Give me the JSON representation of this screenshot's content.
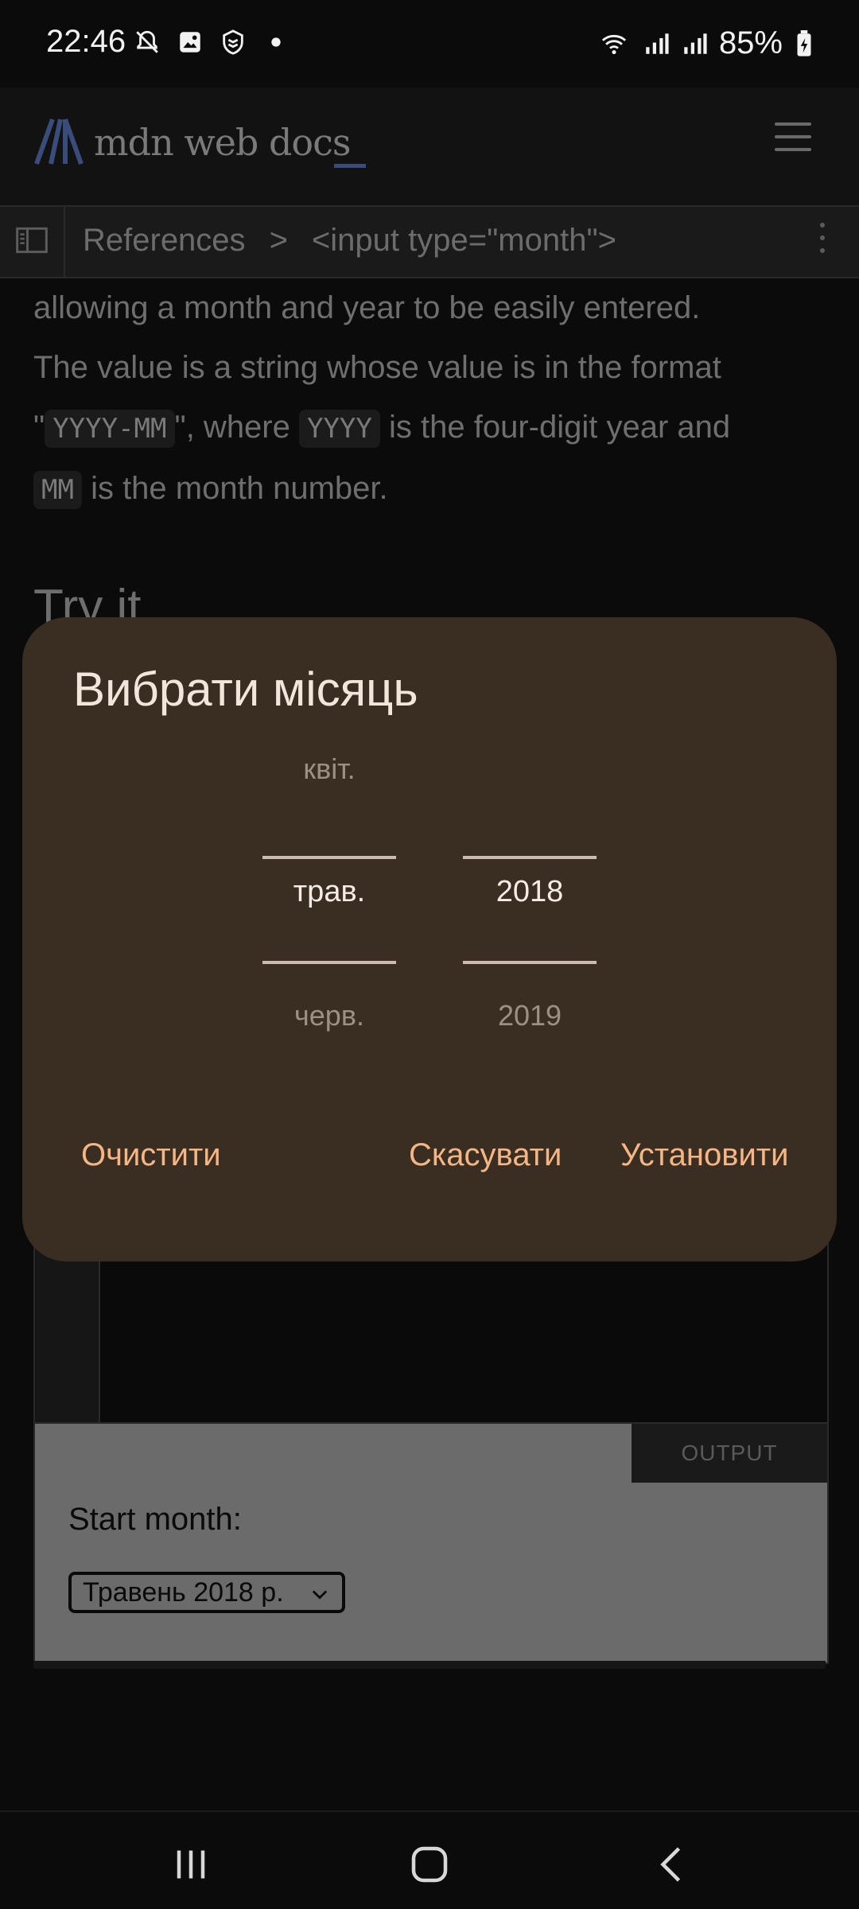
{
  "status_bar": {
    "time": "22:46",
    "battery": "85%",
    "left_icons": [
      "notifications-off-icon",
      "gallery-icon",
      "shield-icon",
      "dot-icon"
    ],
    "right_icons": [
      "wifi-icon",
      "signal-icon",
      "signal-icon",
      "battery-charging-icon"
    ]
  },
  "header": {
    "logo_text": "mdn web docs",
    "logo_cursor": "_",
    "menu_icon": "hamburger-icon"
  },
  "breadcrumb": {
    "items": [
      "References",
      ">",
      "<input type=\"month\">"
    ]
  },
  "article": {
    "line1": "allowing a month and year to be easily entered.",
    "line2": "The value is a string whose value is in the format",
    "q_open": "\"",
    "code1": "YYYY-MM",
    "mid1": "\", where ",
    "code2": "YYYY",
    "mid2": " is the four-digit year and",
    "code3": "MM",
    "mid3": " is the month number.",
    "try_it": "Try it"
  },
  "output": {
    "tab_label": "OUTPUT",
    "start_label": "Start month:",
    "select_value": "Травень 2018 р."
  },
  "dialog": {
    "title": "Вибрати місяць",
    "month_picker": {
      "prev": "квіт.",
      "current": "трав.",
      "next": "черв."
    },
    "year_picker": {
      "prev": "",
      "current": "2018",
      "next": "2019"
    },
    "buttons": {
      "clear": "Очистити",
      "cancel": "Скасувати",
      "set": "Установити"
    }
  },
  "colors": {
    "dialog_bg": "#3a2e23",
    "accent": "#f5b683",
    "title": "#f1e6dc"
  }
}
